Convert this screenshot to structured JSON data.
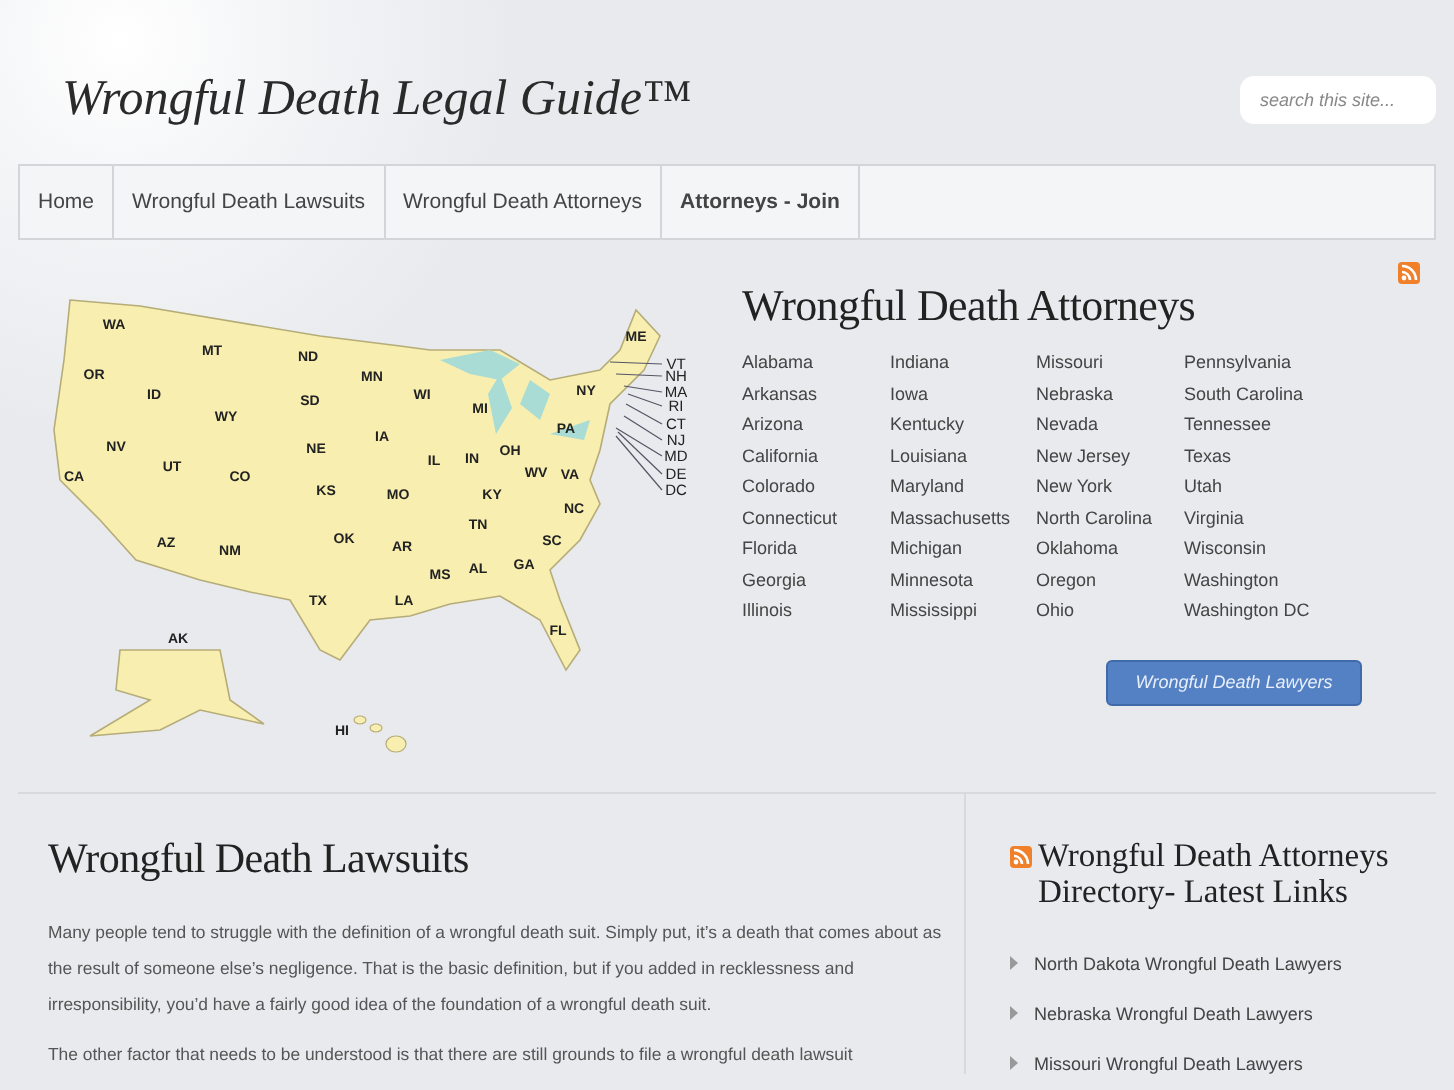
{
  "site_title": "Wrongful Death Legal Guide™",
  "search": {
    "placeholder": "search this site..."
  },
  "nav": [
    {
      "label": "Home",
      "selected": false
    },
    {
      "label": "Wrongful Death Lawsuits",
      "selected": false
    },
    {
      "label": "Wrongful Death Attorneys",
      "selected": false
    },
    {
      "label": "Attorneys - Join",
      "selected": true
    }
  ],
  "map": {
    "state_labels": [
      "WA",
      "MT",
      "ND",
      "MN",
      "ME",
      "OR",
      "ID",
      "WY",
      "SD",
      "WI",
      "MI",
      "NY",
      "IA",
      "NV",
      "UT",
      "CO",
      "NE",
      "IL",
      "IN",
      "OH",
      "PA",
      "CA",
      "KS",
      "MO",
      "KY",
      "WV",
      "VA",
      "NC",
      "TN",
      "AZ",
      "NM",
      "OK",
      "AR",
      "SC",
      "MS",
      "AL",
      "GA",
      "TX",
      "LA",
      "FL",
      "AK",
      "HI"
    ],
    "callout_labels": [
      "VT",
      "NH",
      "MA",
      "RI",
      "CT",
      "NJ",
      "MD",
      "DE",
      "DC"
    ]
  },
  "attorneys": {
    "title": "Wrongful Death Attorneys",
    "states": [
      "Alabama",
      "Arkansas",
      "Arizona",
      "California",
      "Colorado",
      "Connecticut",
      "Florida",
      "Georgia",
      "Illinois",
      "Indiana",
      "Iowa",
      "Kentucky",
      "Louisiana",
      "Maryland",
      "Massachusetts",
      "Michigan",
      "Minnesota",
      "Mississippi",
      "Missouri",
      "Nebraska",
      "Nevada",
      "New Jersey",
      "New York",
      "North Carolina",
      "Oklahoma",
      "Oregon",
      "Ohio",
      "Pennsylvania",
      "South Carolina",
      "Tennessee",
      "Texas",
      "Utah",
      "Virginia",
      "Wisconsin",
      "Washington",
      "Washington DC"
    ],
    "button": "Wrongful Death Lawyers"
  },
  "article": {
    "title": "Wrongful Death Lawsuits",
    "paragraphs": [
      "Many people tend to struggle with the definition of a wrongful death suit. Simply put, it’s a death that comes about as the result of someone else’s negligence. That is the basic definition, but if you added in recklessness and irresponsibility, you’d have a fairly good idea of the foundation of a wrongful death suit.",
      "The other factor that needs to be understood is that there are still grounds to file a wrongful death lawsuit"
    ]
  },
  "sidebar": {
    "title": "Wrongful Death Attorneys Directory- Latest Links",
    "links": [
      "North Dakota Wrongful Death Lawyers",
      "Nebraska Wrongful Death Lawyers",
      "Missouri Wrongful Death Lawyers"
    ]
  }
}
